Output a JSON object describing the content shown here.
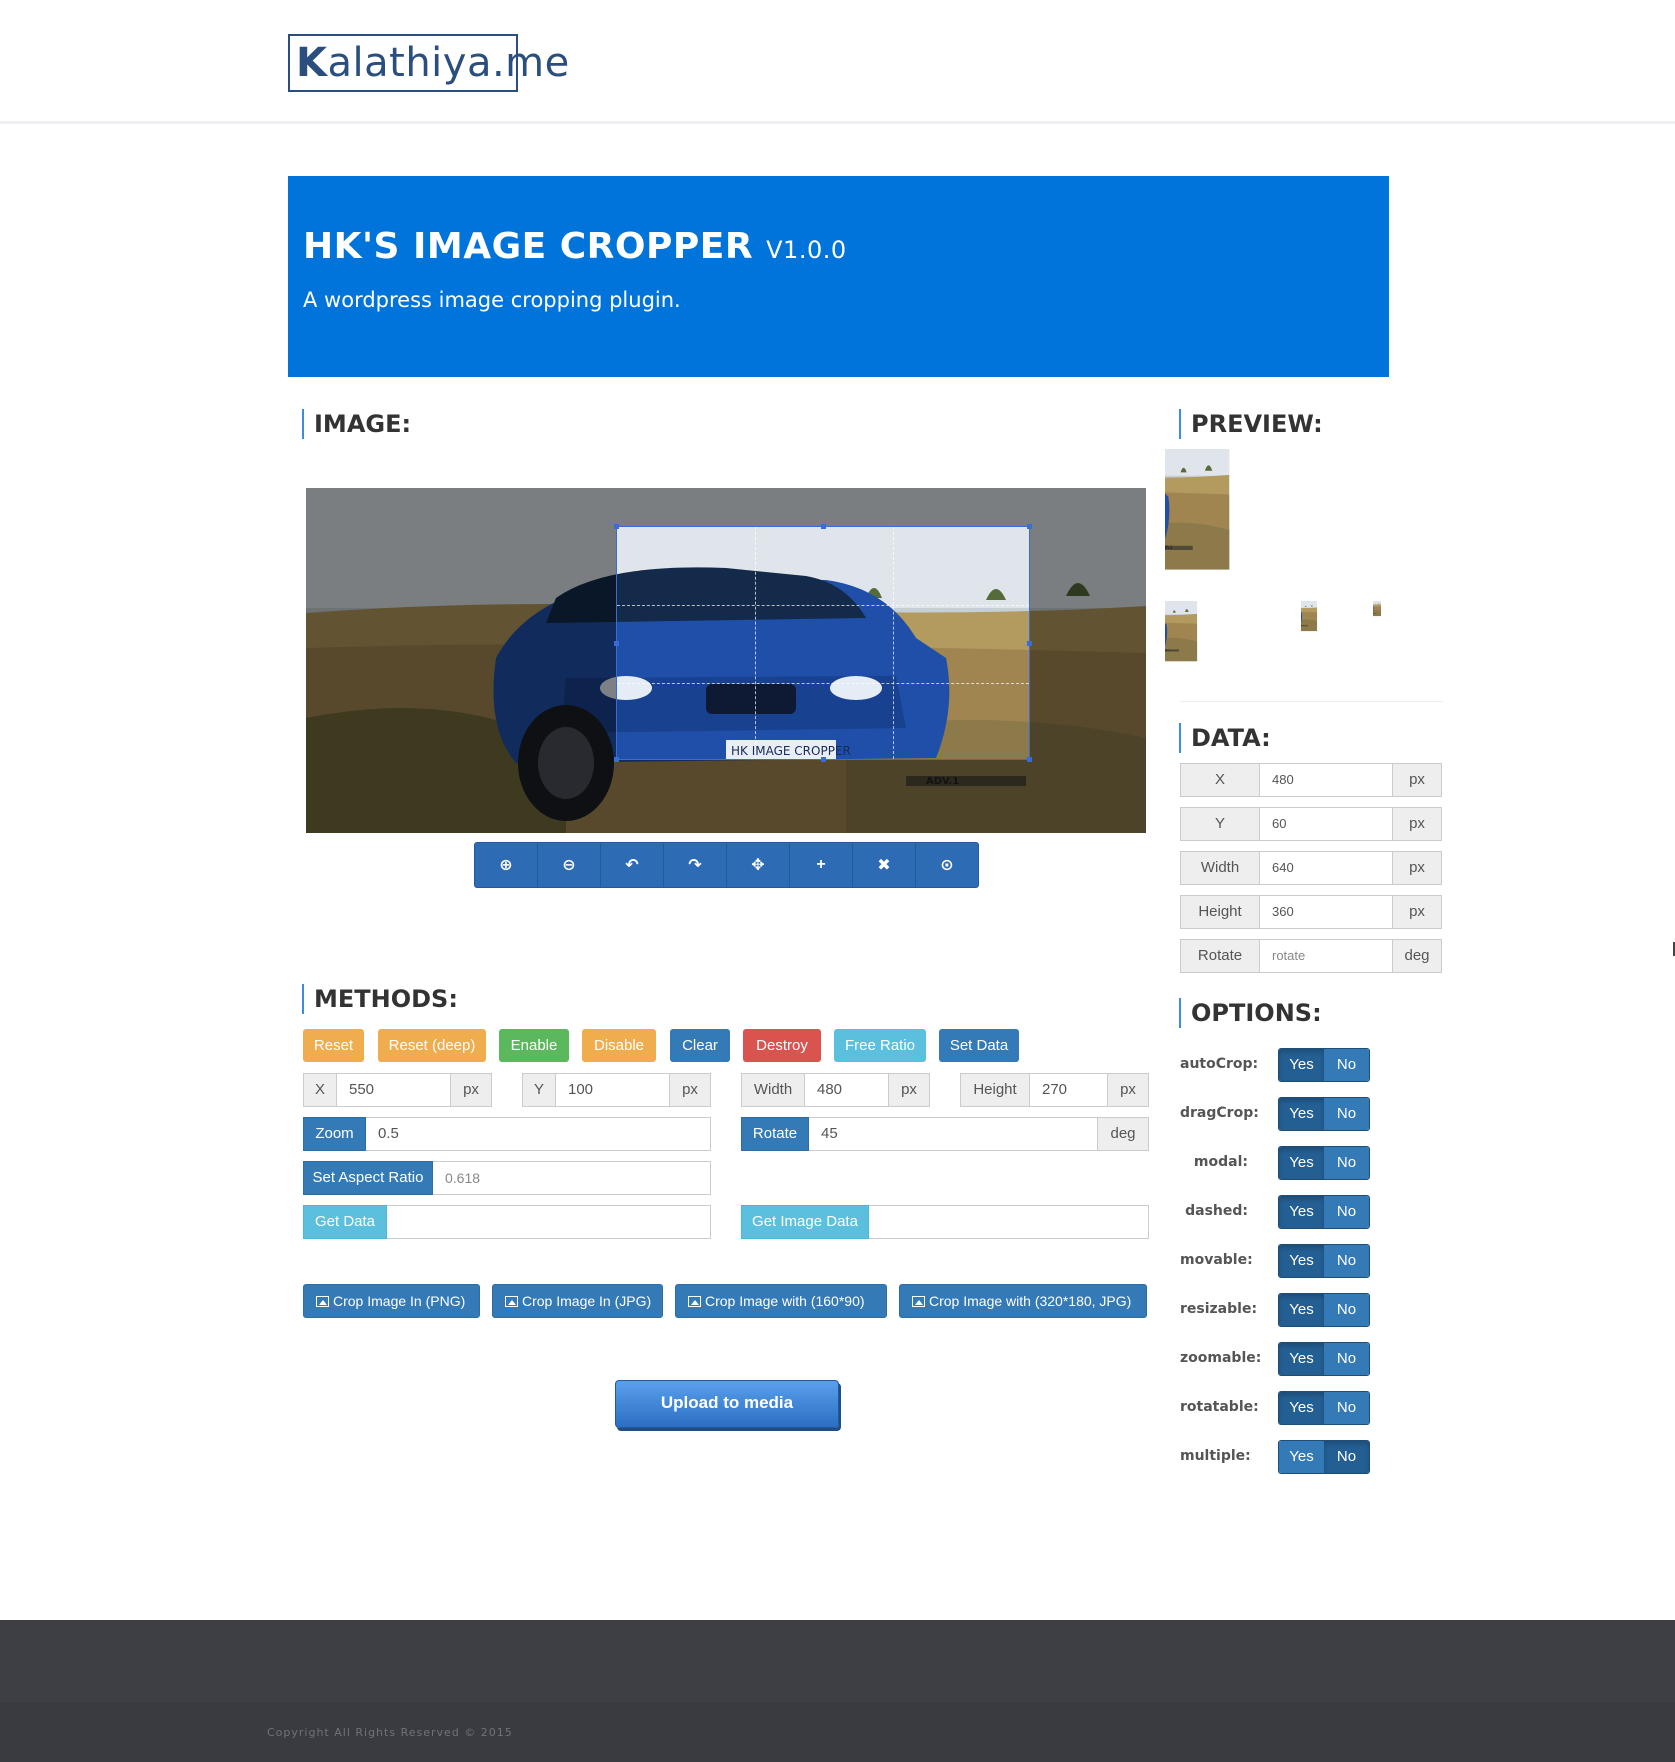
{
  "header": {
    "logo_initial": "K",
    "logo_rest": "alathiya.me"
  },
  "banner": {
    "title": "HK'S IMAGE CROPPER",
    "version": "V1.0.0",
    "subtitle": "A wordpress image cropping plugin."
  },
  "sections": {
    "image": "IMAGE:",
    "preview": "PREVIEW:",
    "data": "DATA:",
    "methods": "METHODS:",
    "options": "OPTIONS:"
  },
  "photo": {
    "plate_text": "HK IMAGE CROPPER",
    "watermark": "ADV.1"
  },
  "toolbar": {
    "icons": [
      "zoom-in-icon",
      "zoom-out-icon",
      "rotate-left-icon",
      "rotate-right-icon",
      "move-icon",
      "crop-icon",
      "clear-icon",
      "upload-icon"
    ],
    "glyphs": [
      "⊕",
      "⊖",
      "↶",
      "↷",
      "✥",
      "+",
      "✖",
      "⊙"
    ]
  },
  "methods": {
    "buttons": [
      "Reset",
      "Reset (deep)",
      "Enable",
      "Disable",
      "Clear",
      "Destroy",
      "Free Ratio",
      "Set Data"
    ],
    "set_data": [
      {
        "label": "X",
        "value": "550",
        "unit": "px"
      },
      {
        "label": "Y",
        "value": "100",
        "unit": "px"
      },
      {
        "label": "Width",
        "value": "480",
        "unit": "px"
      },
      {
        "label": "Height",
        "value": "270",
        "unit": "px"
      }
    ],
    "zoom": {
      "label": "Zoom",
      "value": "0.5"
    },
    "rotate": {
      "label": "Rotate",
      "value": "45",
      "unit": "deg"
    },
    "aspect": {
      "label": "Set Aspect Ratio",
      "placeholder": "0.618"
    },
    "get_data": {
      "label": "Get Data",
      "value": ""
    },
    "get_image_data": {
      "label": "Get Image Data",
      "value": ""
    },
    "crop_buttons": [
      "Crop Image In (PNG)",
      "Crop Image In (JPG)",
      "Crop Image with (160*90)",
      "Crop Image with (320*180, JPG)"
    ],
    "upload": "Upload to media"
  },
  "data": [
    {
      "label": "X",
      "value": "480",
      "unit": "px"
    },
    {
      "label": "Y",
      "value": "60",
      "unit": "px"
    },
    {
      "label": "Width",
      "value": "640",
      "unit": "px"
    },
    {
      "label": "Height",
      "value": "360",
      "unit": "px"
    },
    {
      "label": "Rotate",
      "placeholder": "rotate",
      "unit": "deg"
    }
  ],
  "options": [
    {
      "label": "autoCrop:",
      "selected": "Yes"
    },
    {
      "label": "dragCrop:",
      "selected": "Yes"
    },
    {
      "label": "modal:",
      "selected": "Yes"
    },
    {
      "label": "dashed:",
      "selected": "Yes"
    },
    {
      "label": "movable:",
      "selected": "Yes"
    },
    {
      "label": "resizable:",
      "selected": "Yes"
    },
    {
      "label": "zoomable:",
      "selected": "Yes"
    },
    {
      "label": "rotatable:",
      "selected": "Yes"
    },
    {
      "label": "multiple:",
      "selected": "No"
    }
  ],
  "toggle_labels": {
    "yes": "Yes",
    "no": "No"
  },
  "footer": {
    "copyright": "Copyright All Rights Reserved © 2015"
  },
  "colors": {
    "banner": "#0074db",
    "primary": "#337ab7",
    "warning": "#f0ad4e",
    "success": "#5cb85c",
    "danger": "#d9534f",
    "info": "#5bc0de",
    "footer": "#3d3f44"
  }
}
